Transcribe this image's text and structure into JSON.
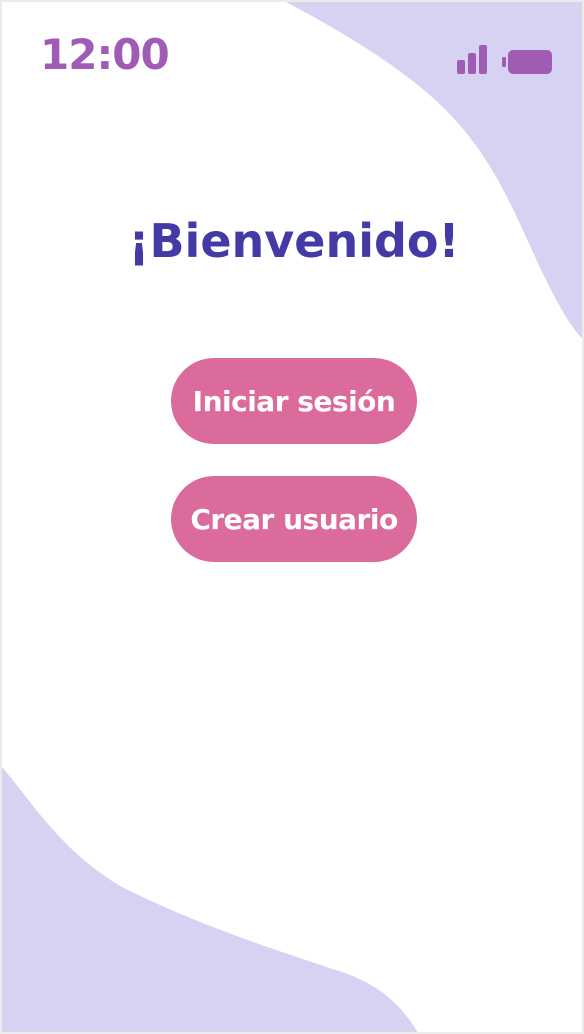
{
  "status_bar": {
    "time": "12:00",
    "signal_icon": "signal-bars-icon",
    "battery_icon": "battery-icon"
  },
  "welcome": {
    "title": "¡Bienvenido!"
  },
  "actions": {
    "login_label": "Iniciar sesión",
    "signup_label": "Crear usuario"
  },
  "colors": {
    "background": "#ffffff",
    "blob": "#d6d2f2",
    "status": "#a05bb5",
    "title": "#433aa5",
    "button": "#dc6b9d",
    "button_text": "#ffffff"
  }
}
